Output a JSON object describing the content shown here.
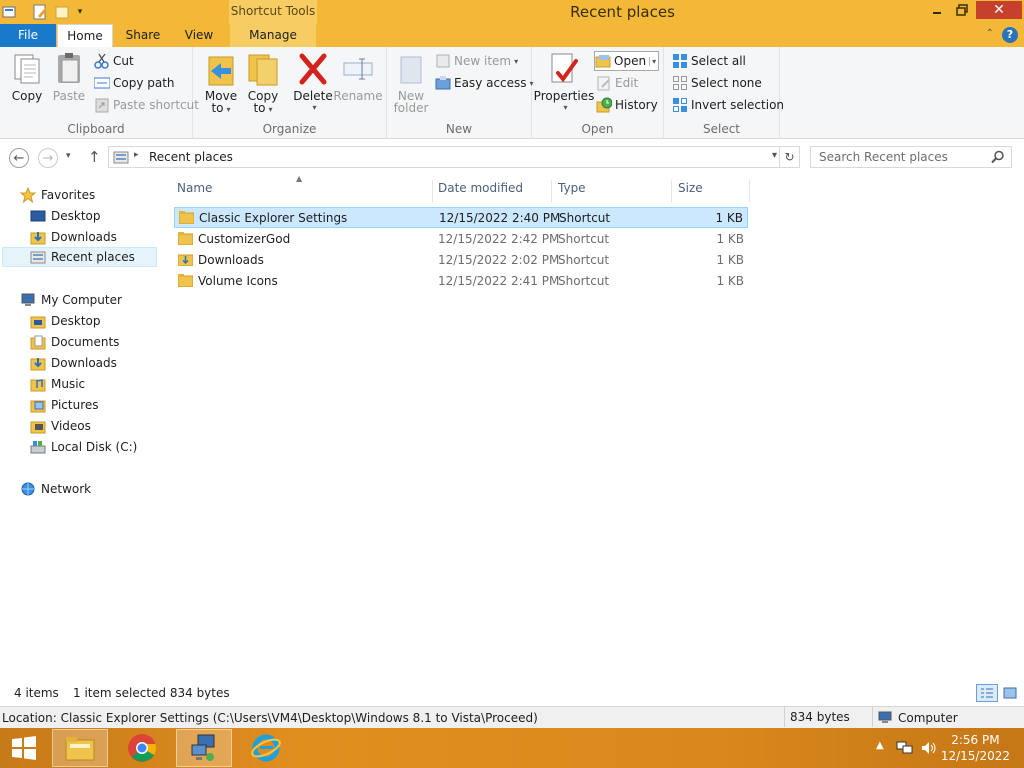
{
  "window": {
    "title": "Recent places",
    "contextual_tab": "Shortcut Tools",
    "colors": {
      "titlebar": "#f3b838",
      "file_tab": "#1979ca",
      "selection": "#cce8ff"
    }
  },
  "tabs": {
    "file": "File",
    "home": "Home",
    "share": "Share",
    "view": "View",
    "manage": "Manage"
  },
  "ribbon": {
    "clipboard": {
      "label": "Clipboard",
      "copy": "Copy",
      "paste": "Paste",
      "cut": "Cut",
      "copy_path": "Copy path",
      "paste_shortcut": "Paste shortcut"
    },
    "organize": {
      "label": "Organize",
      "move_to_1": "Move",
      "move_to_2": "to",
      "copy_to_1": "Copy",
      "copy_to_2": "to",
      "delete": "Delete",
      "rename": "Rename"
    },
    "new": {
      "label": "New",
      "new_folder_1": "New",
      "new_folder_2": "folder",
      "new_item": "New item",
      "easy_access": "Easy access"
    },
    "open": {
      "label": "Open",
      "properties": "Properties",
      "open": "Open",
      "edit": "Edit",
      "history": "History"
    },
    "select": {
      "label": "Select",
      "select_all": "Select all",
      "select_none": "Select none",
      "invert": "Invert selection"
    }
  },
  "address": {
    "breadcrumb": "Recent places",
    "search_placeholder": "Search Recent places"
  },
  "nav": {
    "favorites": "Favorites",
    "fav_items": [
      "Desktop",
      "Downloads",
      "Recent places"
    ],
    "computer": "My Computer",
    "computer_items": [
      "Desktop",
      "Documents",
      "Downloads",
      "Music",
      "Pictures",
      "Videos",
      "Local Disk (C:)"
    ],
    "network": "Network"
  },
  "columns": {
    "name": "Name",
    "date": "Date modified",
    "type": "Type",
    "size": "Size"
  },
  "files": [
    {
      "name": "Classic Explorer Settings",
      "date": "12/15/2022 2:40 PM",
      "type": "Shortcut",
      "size": "1 KB"
    },
    {
      "name": "CustomizerGod",
      "date": "12/15/2022 2:42 PM",
      "type": "Shortcut",
      "size": "1 KB"
    },
    {
      "name": "Downloads",
      "date": "12/15/2022 2:02 PM",
      "type": "Shortcut",
      "size": "1 KB"
    },
    {
      "name": "Volume Icons",
      "date": "12/15/2022 2:41 PM",
      "type": "Shortcut",
      "size": "1 KB"
    }
  ],
  "status": {
    "count": "4 items",
    "selected": "1 item selected  834 bytes"
  },
  "infobar": {
    "location": "Location: Classic Explorer Settings (C:\\Users\\VM4\\Desktop\\Windows 8.1 to Vista\\Proceed)",
    "size": "834 bytes",
    "computer": "Computer"
  },
  "clock": {
    "time": "2:56 PM",
    "date": "12/15/2022"
  }
}
